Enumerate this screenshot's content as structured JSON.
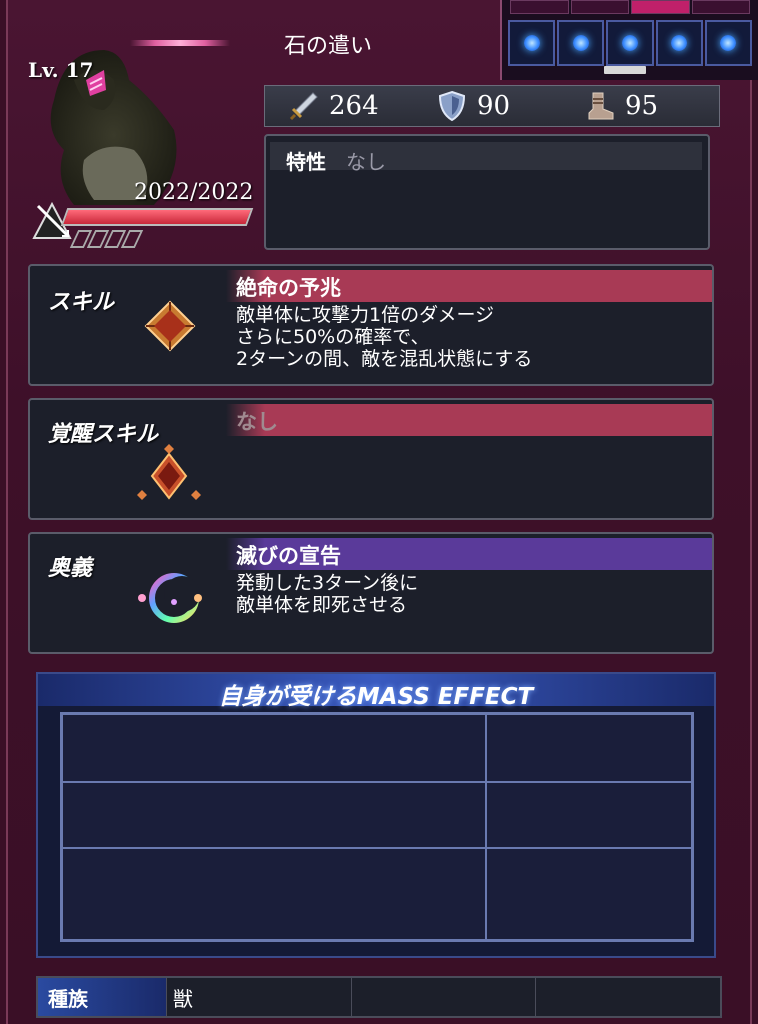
{
  "unit": {
    "name": "石の遣い",
    "level": "Lv. 17",
    "hp": "2022/2022",
    "hp_fraction": 1.0
  },
  "stats": {
    "attack": "264",
    "defense": "90",
    "speed": "95",
    "icons": [
      "sword-icon",
      "shield-icon",
      "boot-icon"
    ]
  },
  "trait": {
    "label": "特性",
    "value": "なし"
  },
  "skill": {
    "label": "スキル",
    "title": "絶命の予兆",
    "desc_lines": [
      "敵単体に攻撃力1倍のダメージ",
      "さらに50%の確率で、",
      "2ターンの間、敵を混乱状態にする"
    ]
  },
  "awaken_skill": {
    "label": "覚醒スキル",
    "title": "なし"
  },
  "ougi": {
    "label": "奥義",
    "title": "滅びの宣告",
    "desc_lines": [
      "発動した3ターン後に",
      "敵単体を即死させる"
    ]
  },
  "mass_effect": {
    "title": "自身が受けるMASS EFFECT"
  },
  "race": {
    "label": "種族",
    "values": [
      "獣",
      "",
      "",
      ""
    ]
  },
  "colors": {
    "skill_header": "#a83a55",
    "ougi_header": "#5a3a9a",
    "mass_header": "#3a5ac0",
    "orb": "#3a8cff"
  }
}
